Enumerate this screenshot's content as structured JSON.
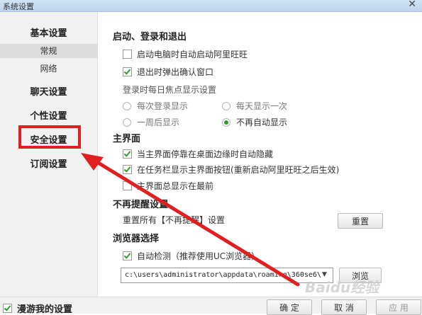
{
  "window": {
    "title": "系统设置"
  },
  "sidebar": {
    "basic": "基本设置",
    "general": "常规",
    "network": "网络",
    "chat": "聊天设置",
    "personal": "个性设置",
    "security": "安全设置",
    "subscription": "订阅设置"
  },
  "startup": {
    "heading": "启动、登录和退出",
    "auto_start": "启动电脑时自动启动阿里旺旺",
    "confirm_exit": "退出时弹出确认窗口",
    "focus_heading": "登录时每日焦点显示设置",
    "every_login": "每次登录显示",
    "once_daily": "每天显示一次",
    "after_week": "一周后显示",
    "never_auto": "不再自动显示"
  },
  "main_ui": {
    "heading": "主界面",
    "auto_hide": "当主界面停靠在桌面边缘时自动隐藏",
    "taskbar_button": "在任务栏显示主界面按钮(重新启动阿里旺旺之后生效)",
    "always_top": "主界面总显示在最前"
  },
  "reminder": {
    "heading": "不再提醒设置",
    "reset_text": "重置所有【不再提醒】设置",
    "reset_button": "重置"
  },
  "browser": {
    "heading": "浏览器选择",
    "auto_detect": "自动检测（推荐使用UC浏览器）",
    "path": "c:\\users\\administrator\\appdata\\roaming\\360se6\\",
    "browse_button": "浏览"
  },
  "footer": {
    "roam": "漫游我的设置",
    "ok": "确 定",
    "cancel": "取 消",
    "apply": "应 用"
  },
  "watermark": "Baidu经验",
  "colors": {
    "highlight": "#e02020",
    "check": "#2a9d2a"
  }
}
